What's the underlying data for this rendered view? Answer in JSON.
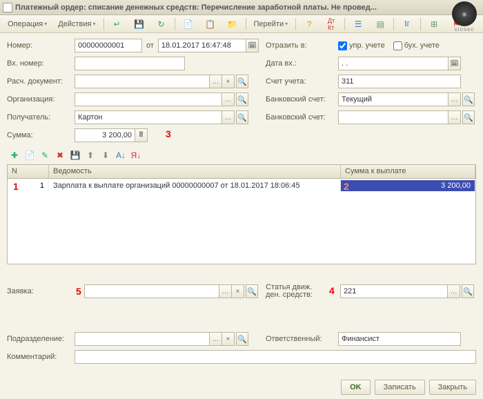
{
  "title": "Платежный ордер: списание денежных средств: Перечисление заработной платы. Не провед...",
  "logo_text": "stosec",
  "toolbar": {
    "operation": "Операция",
    "actions": "Действия",
    "goto": "Перейти"
  },
  "labels": {
    "number": "Номер:",
    "from": "от",
    "incoming_num": "Вх. номер:",
    "settlement_doc": "Расч. документ:",
    "organization": "Организация:",
    "recipient": "Получатель:",
    "sum": "Сумма:",
    "reflect_in": "Отразить в:",
    "mgmt_acct": "упр. учете",
    "bugh_acct": "бух. учете",
    "date_in": "Дата вх.:",
    "account": "Счет учета:",
    "bank_account": "Банковский счет:",
    "bank_account2": "Банковский счет:",
    "request": "Заявка:",
    "cash_flow": "Статья движ. ден. средств:",
    "subdivision": "Подразделение:",
    "responsible": "Ответственный:",
    "comment": "Комментарий:"
  },
  "values": {
    "number": "00000000001",
    "date": "18.01.2017 16:47:48",
    "date_in": ". .",
    "account": "311",
    "bank_account": "Текущий",
    "recipient": "Картон",
    "sum": "3 200,00",
    "cash_flow": "221",
    "responsible": "Финансист"
  },
  "annotations": {
    "n1": "1",
    "n2": "2",
    "n3": "3",
    "n4": "4",
    "n5": "5"
  },
  "grid": {
    "headers": {
      "n": "N",
      "statement": "Ведомость",
      "amount": "Сумма к выплате"
    },
    "rows": [
      {
        "n": "1",
        "statement": "Зарплата к выплате организаций 00000000007 от 18.01.2017 18:06:45",
        "amount": "3 200,00"
      }
    ]
  },
  "footer": {
    "ok": "OK",
    "save": "Записать",
    "close": "Закрыть"
  }
}
